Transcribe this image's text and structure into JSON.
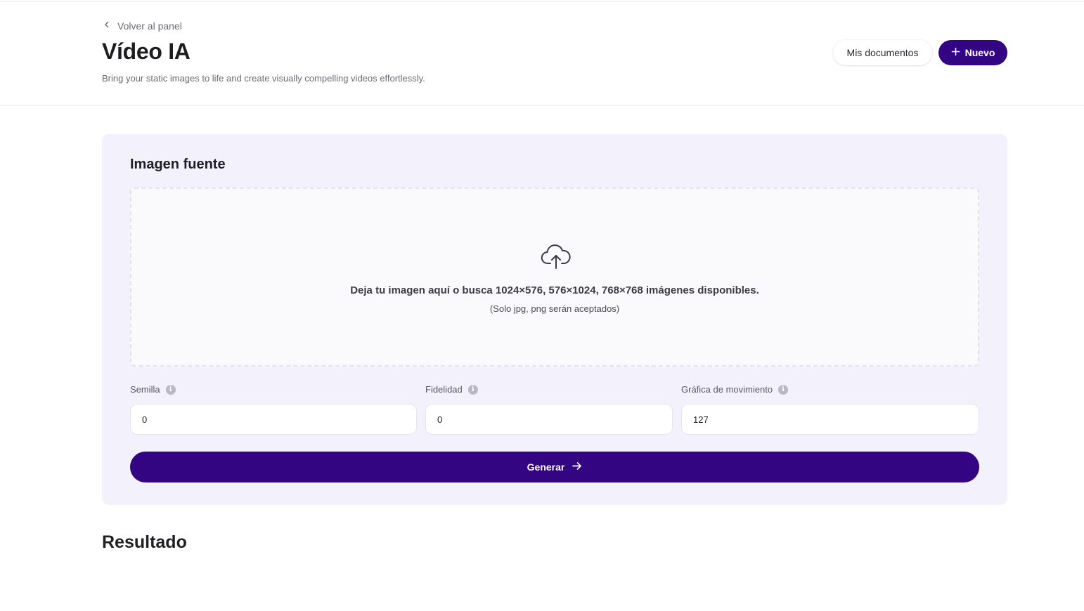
{
  "header": {
    "back_label": "Volver al panel",
    "title": "Vídeo IA",
    "subtitle": "Bring your static images to life and create visually compelling videos effortlessly.",
    "docs_button": "Mis documentos",
    "new_button": "Nuevo"
  },
  "source": {
    "title": "Imagen fuente",
    "dropzone_text": "Deja tu imagen aquí o busca 1024×576, 576×1024, 768×768 imágenes disponibles.",
    "dropzone_note": "(Solo jpg, png serán aceptados)"
  },
  "fields": [
    {
      "label": "Semilla",
      "value": "0"
    },
    {
      "label": "Fidelidad",
      "value": "0"
    },
    {
      "label": "Gráfica de movimiento",
      "value": "127"
    }
  ],
  "generate_button": "Generar",
  "result_title": "Resultado",
  "colors": {
    "accent": "#330582",
    "card_bg": "#f2f1fc"
  },
  "icons": {
    "back": "chevron-left-icon",
    "new": "plus-icon",
    "upload": "cloud-upload-icon",
    "info": "info-icon",
    "generate": "arrow-right-icon"
  }
}
